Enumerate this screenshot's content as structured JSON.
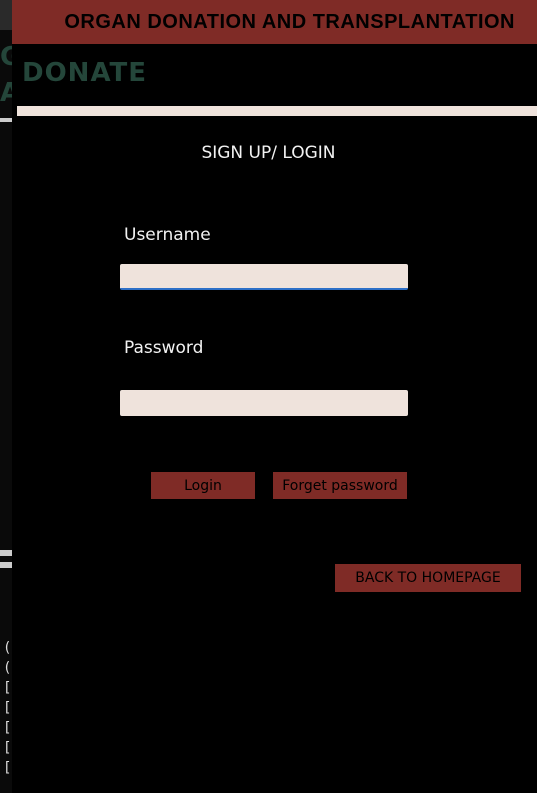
{
  "header": {
    "title": "ORGAN DONATION AND TRANSPLANTATION",
    "logo_text": "DONATE"
  },
  "form": {
    "heading": "SIGN UP/ LOGIN",
    "username_label": "Username",
    "username_value": "",
    "password_label": "Password",
    "password_value": ""
  },
  "buttons": {
    "login": "Login",
    "forget_password": "Forget password",
    "back_to_homepage": "BACK TO HOMEPAGE"
  },
  "background_window": {
    "letters": [
      "G",
      "A"
    ],
    "text_fragments": [
      "(",
      "(",
      "[",
      "[",
      "[",
      "[",
      "["
    ]
  },
  "colors": {
    "accent": "#7f2b26",
    "logo_green": "#24463a",
    "field_bg": "#efe3dc",
    "page_bg": "#000000"
  }
}
